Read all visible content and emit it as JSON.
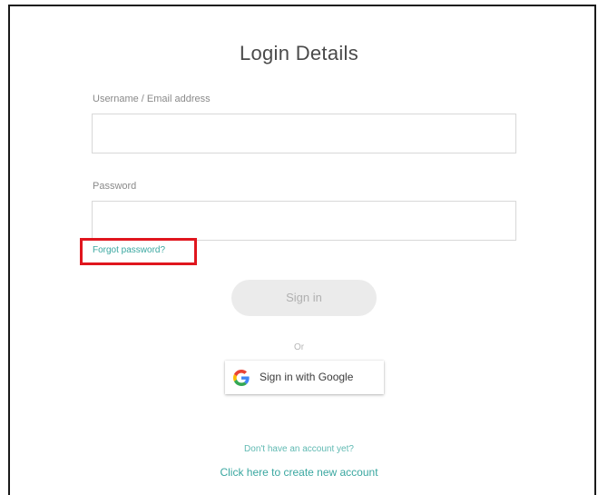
{
  "form": {
    "title": "Login Details",
    "username_label": "Username / Email address",
    "username_value": "",
    "password_label": "Password",
    "password_value": "",
    "forgot_password": "Forgot password?",
    "sign_in": "Sign in",
    "or_text": "Or",
    "google_sign_in": "Sign in with Google",
    "no_account_text": "Don't have an account yet?",
    "create_account_link": "Click here to create new account"
  },
  "colors": {
    "highlight_box": "#e0161e",
    "link": "#3aa7a0",
    "button_disabled": "#ebebeb"
  }
}
